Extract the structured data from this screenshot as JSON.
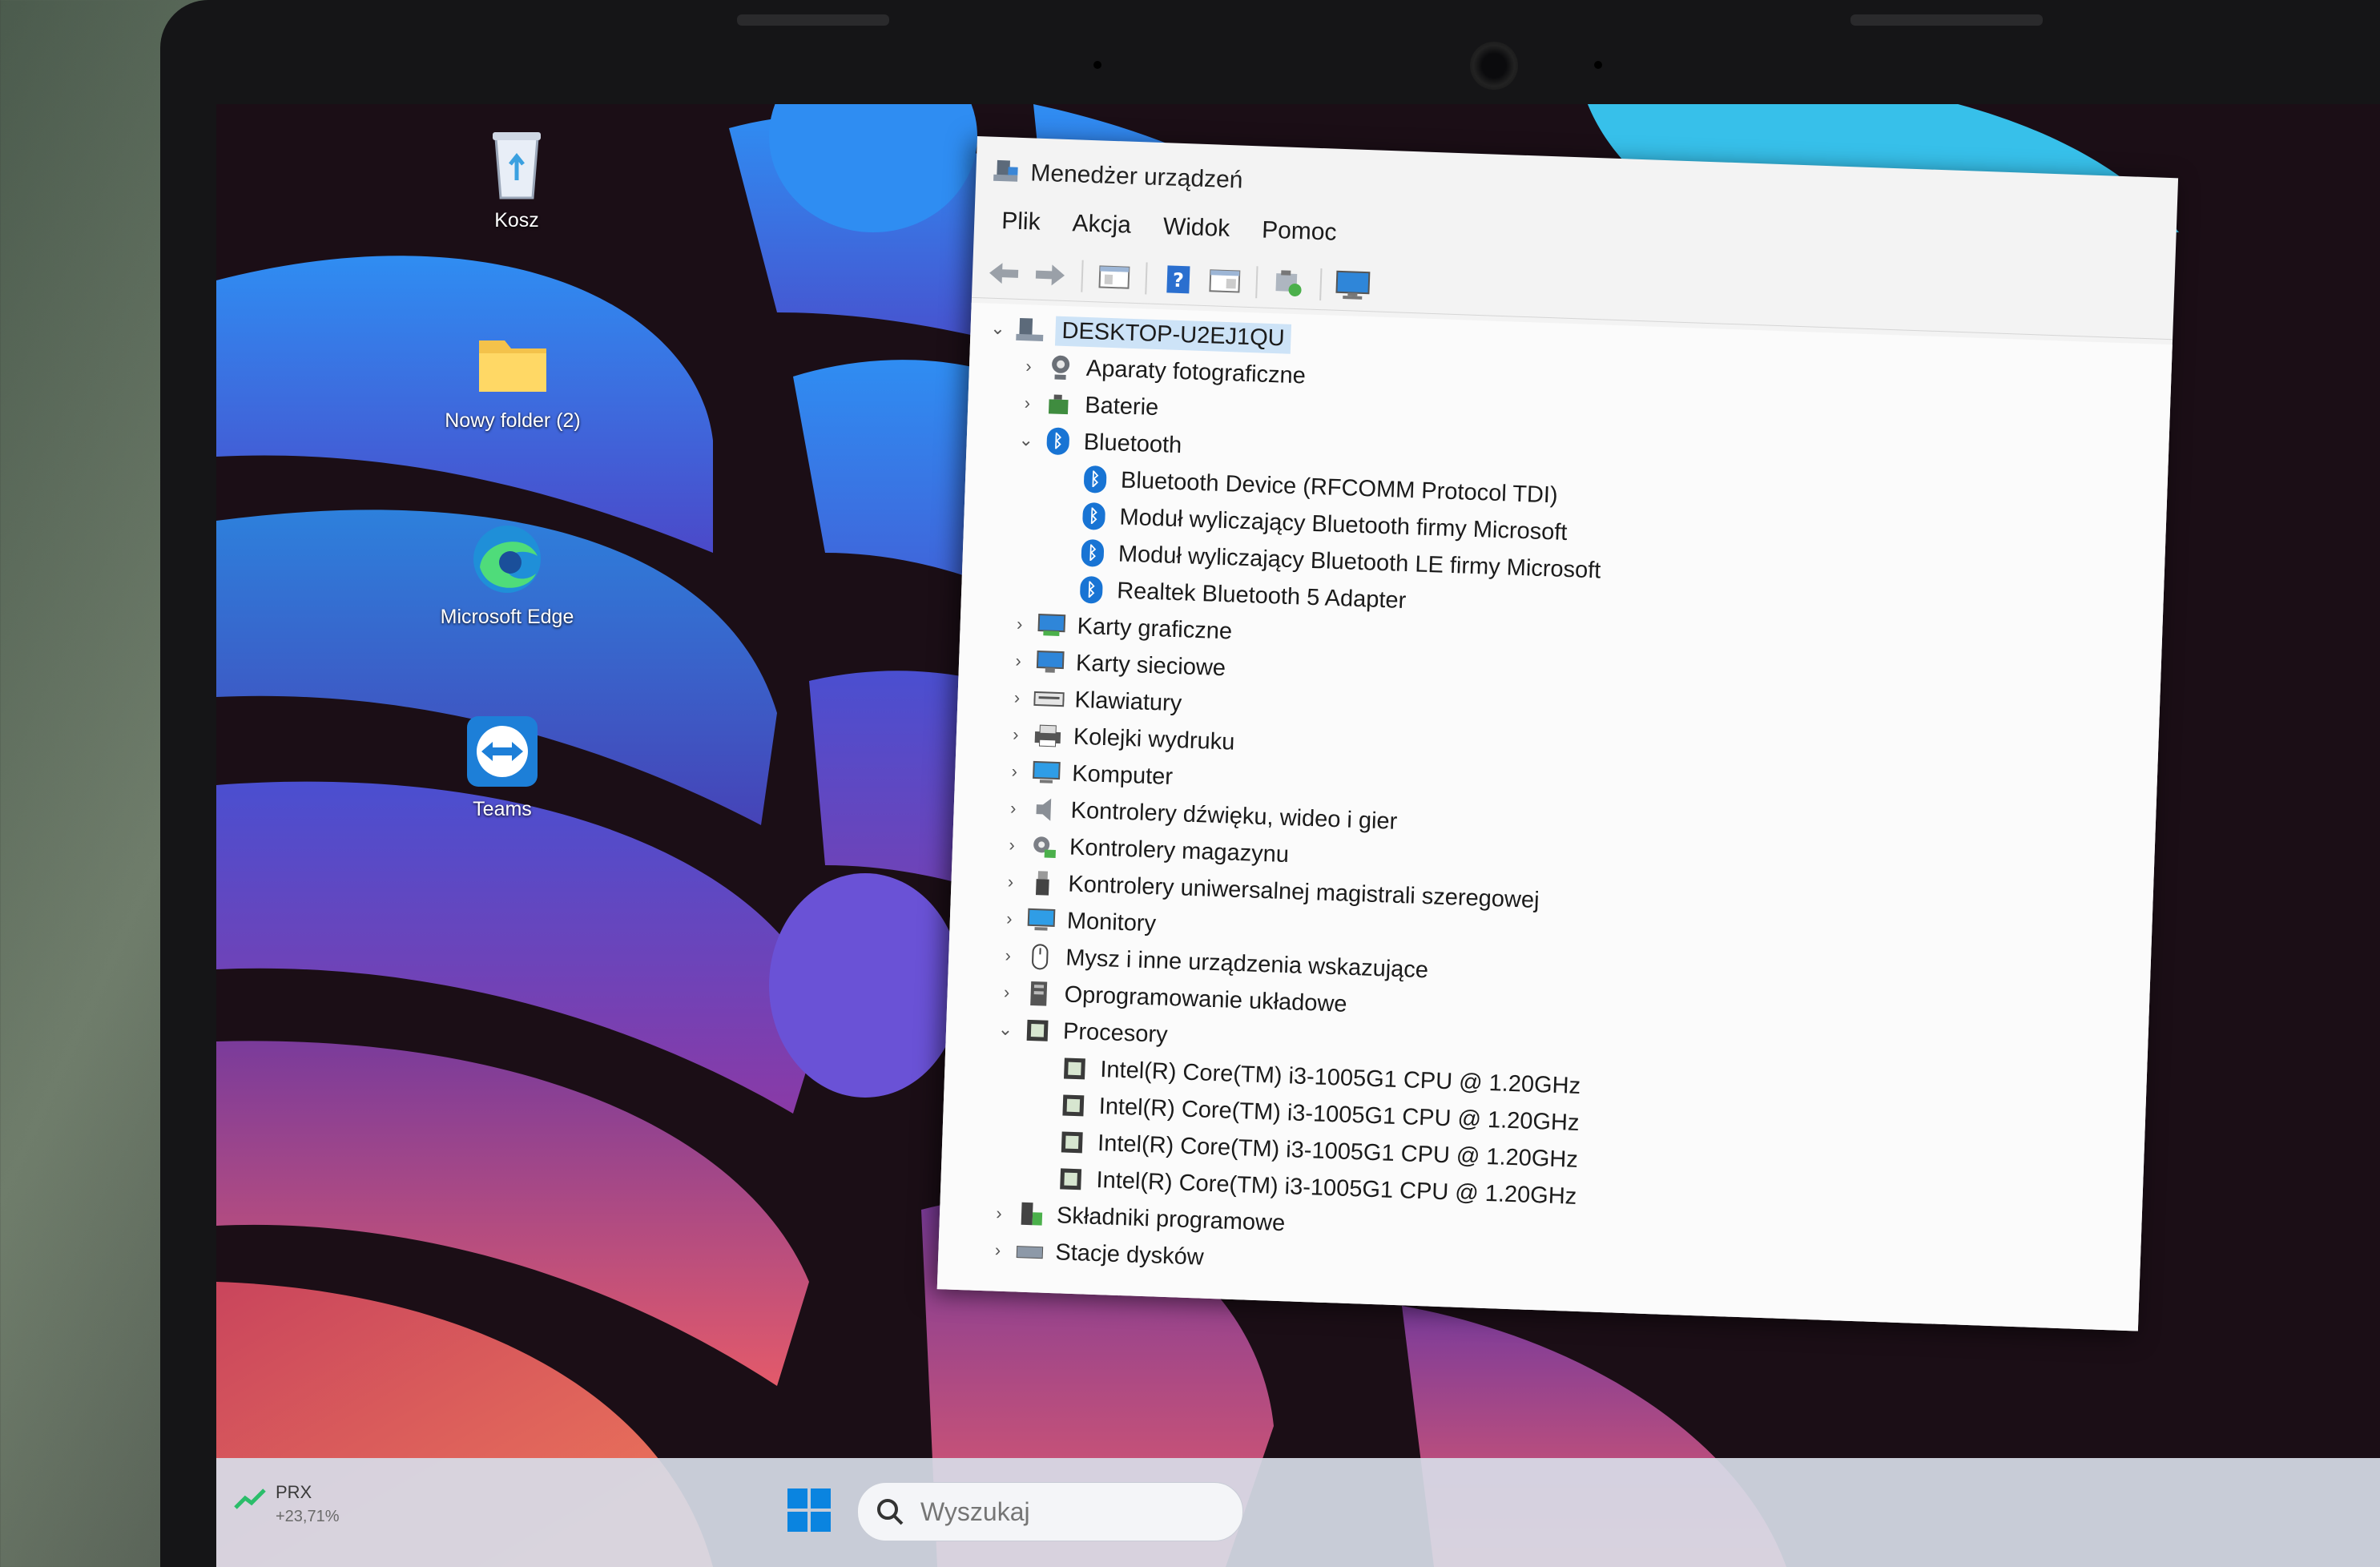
{
  "desktop": {
    "icons": [
      {
        "id": "recycle-bin",
        "label": "Kosz"
      },
      {
        "id": "new-folder",
        "label": "Nowy folder (2)"
      },
      {
        "id": "edge",
        "label": "Microsoft Edge"
      },
      {
        "id": "teams",
        "label": "Teams"
      }
    ]
  },
  "taskbar": {
    "ticker": {
      "symbol": "PRX",
      "change": "+23,71%"
    },
    "search_placeholder": "Wyszukaj",
    "colors": {
      "accent": "#0078d4"
    }
  },
  "device_manager": {
    "title": "Menedżer urządzeń",
    "menu": [
      "Plik",
      "Akcja",
      "Widok",
      "Pomoc"
    ],
    "toolbar_icons": [
      "back-arrow-icon",
      "forward-arrow-icon",
      "properties-icon",
      "help-icon",
      "view-icon",
      "update-driver-icon",
      "monitor-icon"
    ],
    "tree": [
      {
        "level": 0,
        "label": "DESKTOP-U2EJ1QU",
        "expanded": true,
        "icon": "computer-icon",
        "root": true
      },
      {
        "level": 1,
        "label": "Aparaty fotograficzne",
        "expanded": false,
        "icon": "camera-icon"
      },
      {
        "level": 1,
        "label": "Baterie",
        "expanded": false,
        "icon": "battery-icon"
      },
      {
        "level": 1,
        "label": "Bluetooth",
        "expanded": true,
        "icon": "bluetooth-icon"
      },
      {
        "level": 2,
        "label": "Bluetooth Device (RFCOMM Protocol TDI)",
        "icon": "bluetooth-icon"
      },
      {
        "level": 2,
        "label": "Moduł wyliczający Bluetooth firmy Microsoft",
        "icon": "bluetooth-icon"
      },
      {
        "level": 2,
        "label": "Moduł wyliczający Bluetooth LE firmy Microsoft",
        "icon": "bluetooth-icon"
      },
      {
        "level": 2,
        "label": "Realtek Bluetooth 5 Adapter",
        "icon": "bluetooth-icon"
      },
      {
        "level": 1,
        "label": "Karty graficzne",
        "expanded": false,
        "icon": "display-adapter-icon"
      },
      {
        "level": 1,
        "label": "Karty sieciowe",
        "expanded": false,
        "icon": "network-adapter-icon"
      },
      {
        "level": 1,
        "label": "Klawiatury",
        "expanded": false,
        "icon": "keyboard-icon"
      },
      {
        "level": 1,
        "label": "Kolejki wydruku",
        "expanded": false,
        "icon": "printer-icon"
      },
      {
        "level": 1,
        "label": "Komputer",
        "expanded": false,
        "icon": "monitor-icon"
      },
      {
        "level": 1,
        "label": "Kontrolery dźwięku, wideo i gier",
        "expanded": false,
        "icon": "speaker-icon"
      },
      {
        "level": 1,
        "label": "Kontrolery magazynu",
        "expanded": false,
        "icon": "storage-controller-icon"
      },
      {
        "level": 1,
        "label": "Kontrolery uniwersalnej magistrali szeregowej",
        "expanded": false,
        "icon": "usb-icon"
      },
      {
        "level": 1,
        "label": "Monitory",
        "expanded": false,
        "icon": "monitor-icon"
      },
      {
        "level": 1,
        "label": "Mysz i inne urządzenia wskazujące",
        "expanded": false,
        "icon": "mouse-icon"
      },
      {
        "level": 1,
        "label": "Oprogramowanie układowe",
        "expanded": false,
        "icon": "firmware-icon"
      },
      {
        "level": 1,
        "label": "Procesory",
        "expanded": true,
        "icon": "cpu-icon"
      },
      {
        "level": 2,
        "label": "Intel(R) Core(TM) i3-1005G1 CPU @ 1.20GHz",
        "icon": "cpu-icon"
      },
      {
        "level": 2,
        "label": "Intel(R) Core(TM) i3-1005G1 CPU @ 1.20GHz",
        "icon": "cpu-icon"
      },
      {
        "level": 2,
        "label": "Intel(R) Core(TM) i3-1005G1 CPU @ 1.20GHz",
        "icon": "cpu-icon"
      },
      {
        "level": 2,
        "label": "Intel(R) Core(TM) i3-1005G1 CPU @ 1.20GHz",
        "icon": "cpu-icon"
      },
      {
        "level": 1,
        "label": "Składniki programowe",
        "expanded": false,
        "icon": "software-component-icon"
      },
      {
        "level": 1,
        "label": "Stacje dysków",
        "expanded": false,
        "icon": "disk-drive-icon"
      }
    ]
  }
}
